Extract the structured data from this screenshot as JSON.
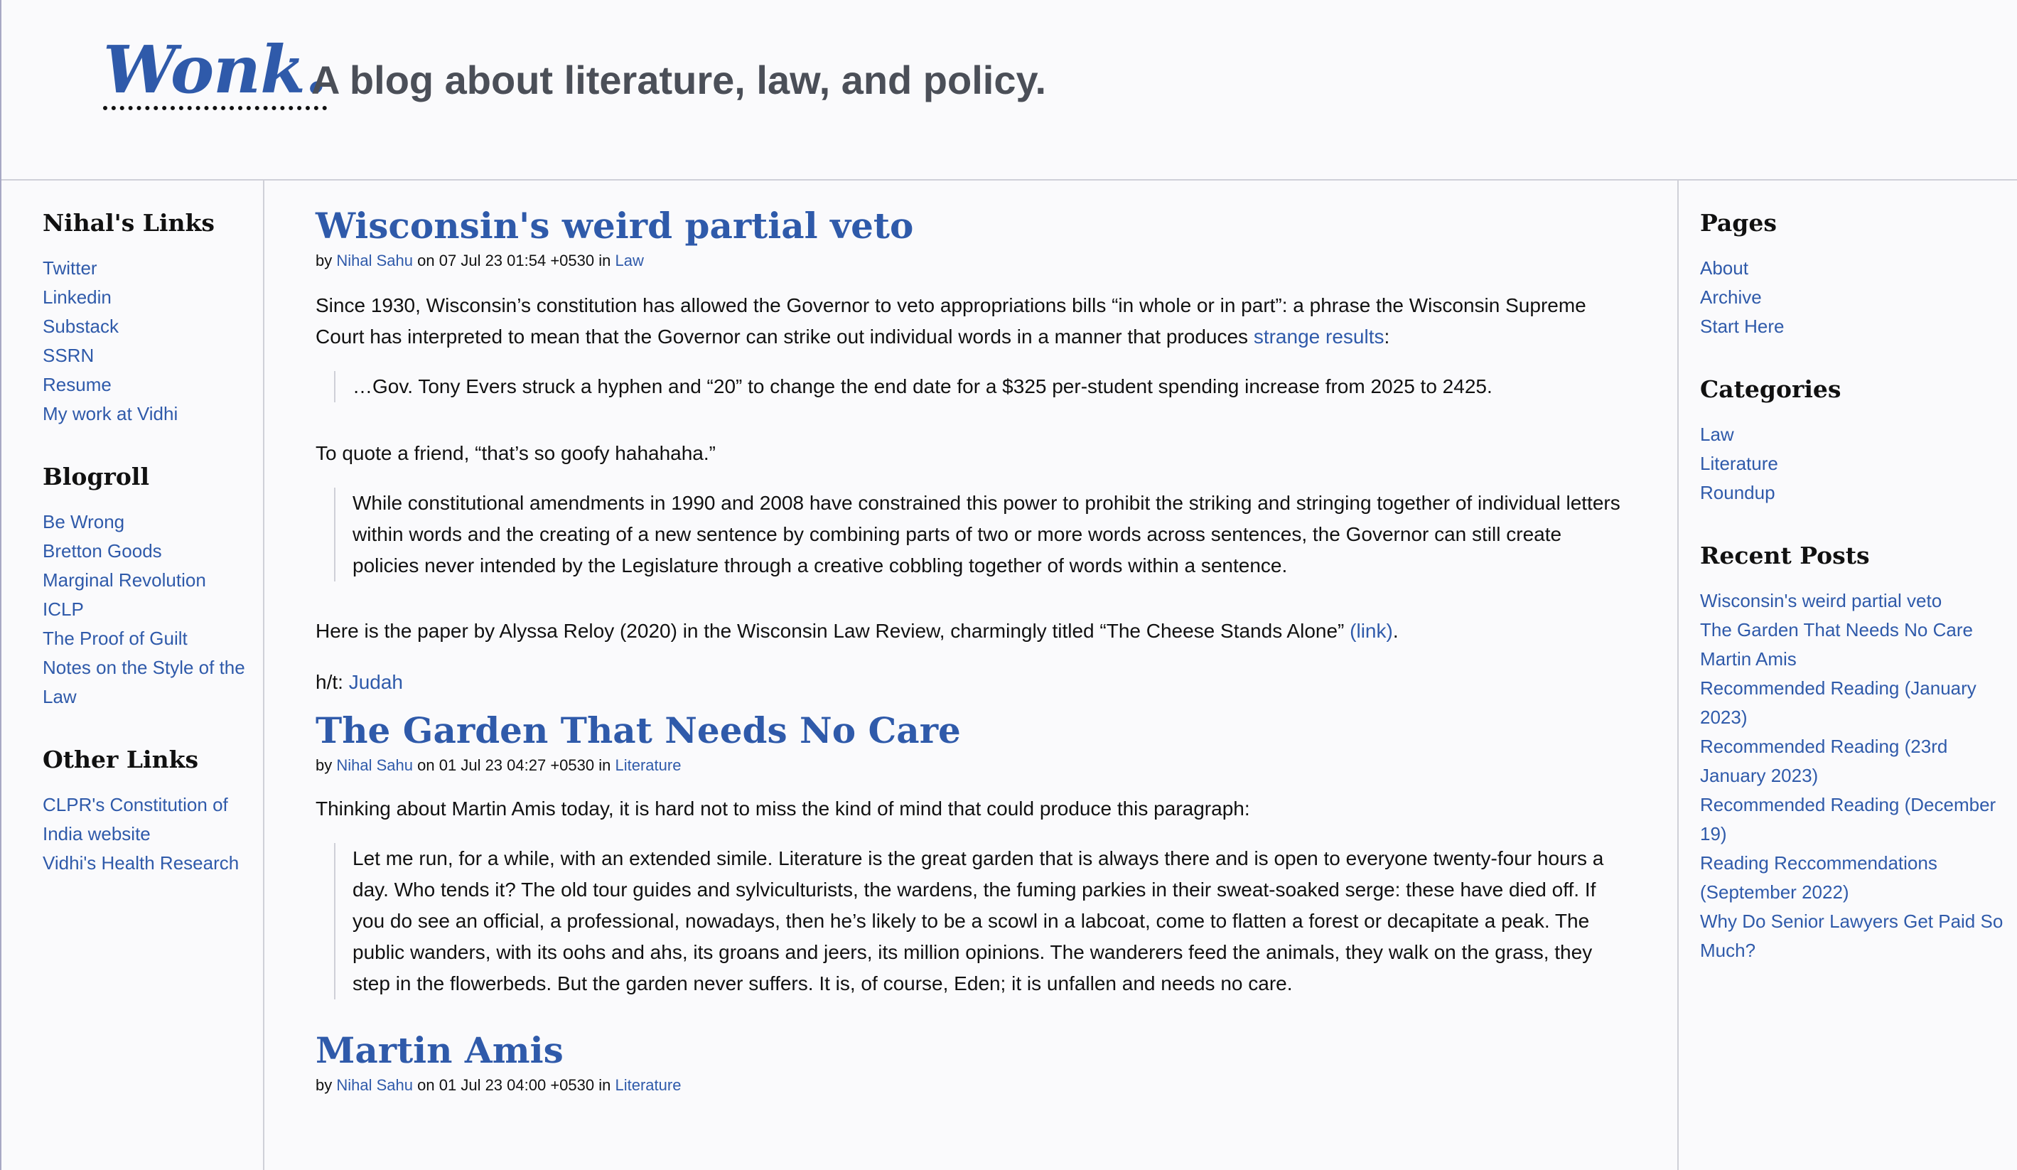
{
  "site": {
    "brand": "Wonk.",
    "tagline": "A blog about literature, law, and policy."
  },
  "left_sidebar": {
    "sections": [
      {
        "heading": "Nihal's Links",
        "items": [
          "Twitter",
          "Linkedin",
          "Substack",
          "SSRN",
          "Resume",
          "My work at Vidhi"
        ]
      },
      {
        "heading": "Blogroll",
        "items": [
          "Be Wrong",
          "Bretton Goods",
          "Marginal Revolution",
          "ICLP",
          "The Proof of Guilt",
          "Notes on the Style of the Law"
        ]
      },
      {
        "heading": "Other Links",
        "items": [
          "CLPR's Constitution of India website",
          "Vidhi's Health Research"
        ]
      }
    ]
  },
  "right_sidebar": {
    "sections": [
      {
        "heading": "Pages",
        "items": [
          "About",
          "Archive",
          "Start Here"
        ]
      },
      {
        "heading": "Categories",
        "items": [
          "Law",
          "Literature",
          "Roundup"
        ]
      },
      {
        "heading": "Recent Posts",
        "items": [
          "Wisconsin's weird partial veto",
          "The Garden That Needs No Care",
          "Martin Amis",
          "Recommended Reading (January 2023)",
          "Recommended Reading (23rd January 2023)",
          "Recommended Reading (December 19)",
          "Reading Reccommendations (September 2022)",
          "Why Do Senior Lawyers Get Paid So Much?"
        ]
      }
    ]
  },
  "posts": [
    {
      "title": "Wisconsin's weird partial veto",
      "by_label": "by",
      "author": "Nihal Sahu",
      "on_label": "on",
      "date": "07 Jul 23 01:54 +0530",
      "in_label": "in",
      "category": "Law",
      "p1_text": "Since 1930, Wisconsin’s constitution has allowed the Governor to veto appropriations bills “in whole or in part”: a phrase the Wisconsin Supreme Court has interpreted to mean that the Governor can strike out individual words in a manner that produces ",
      "p1_link": "strange results",
      "p1_end": ":",
      "quote1": "…Gov. Tony Evers struck a hyphen and “20” to change the end date for a $325 per-student spending increase from 2025 to 2425.",
      "p2": "To quote a friend, “that’s so goofy hahahaha.”",
      "quote2": "While constitutional amendments in 1990 and 2008 have constrained this power to prohibit the striking and stringing together of individual letters within words and the creating of a new sentence by combining parts of two or more words across sentences, the Governor can still create policies never intended by the Legislature through a creative cobbling together of words within a sentence.",
      "p3_text": "Here is the paper by Alyssa Reloy (2020) in the Wisconsin Law Review, charmingly titled “The Cheese Stands Alone” ",
      "p3_link": "(link)",
      "p3_end": ".",
      "p4_text": "h/t: ",
      "p4_link": "Judah"
    },
    {
      "title": "The Garden That Needs No Care",
      "by_label": "by",
      "author": "Nihal Sahu",
      "on_label": "on",
      "date": "01 Jul 23 04:27 +0530",
      "in_label": "in",
      "category": "Literature",
      "p1": "Thinking about Martin Amis today, it is hard not to miss the kind of mind that could produce this paragraph:",
      "quote": "Let me run, for a while, with an extended simile. Literature is the great garden that is always there and is open to everyone twenty-four hours a day. Who tends it? The old tour guides and sylviculturists, the wardens, the fuming parkies in their sweat-soaked serge: these have died off. If you do see an official, a professional, nowadays, then he’s likely to be a scowl in a labcoat, come to flatten a forest or decapitate a peak. The public wanders, with its oohs and ahs, its groans and jeers, its million opinions. The wanderers feed the animals, they walk on the grass, they step in the flowerbeds. But the garden never suffers. It is, of course, Eden; it is unfallen and needs no care."
    },
    {
      "title": "Martin Amis",
      "by_label": "by",
      "author": "Nihal Sahu",
      "on_label": "on",
      "date": "01 Jul 23 04:00 +0530",
      "in_label": "in",
      "category": "Literature"
    }
  ],
  "colors": {
    "link": "#2f5aaa",
    "background": "#fafafc",
    "tagline": "#4b4f58",
    "border": "#cfd0d8"
  }
}
